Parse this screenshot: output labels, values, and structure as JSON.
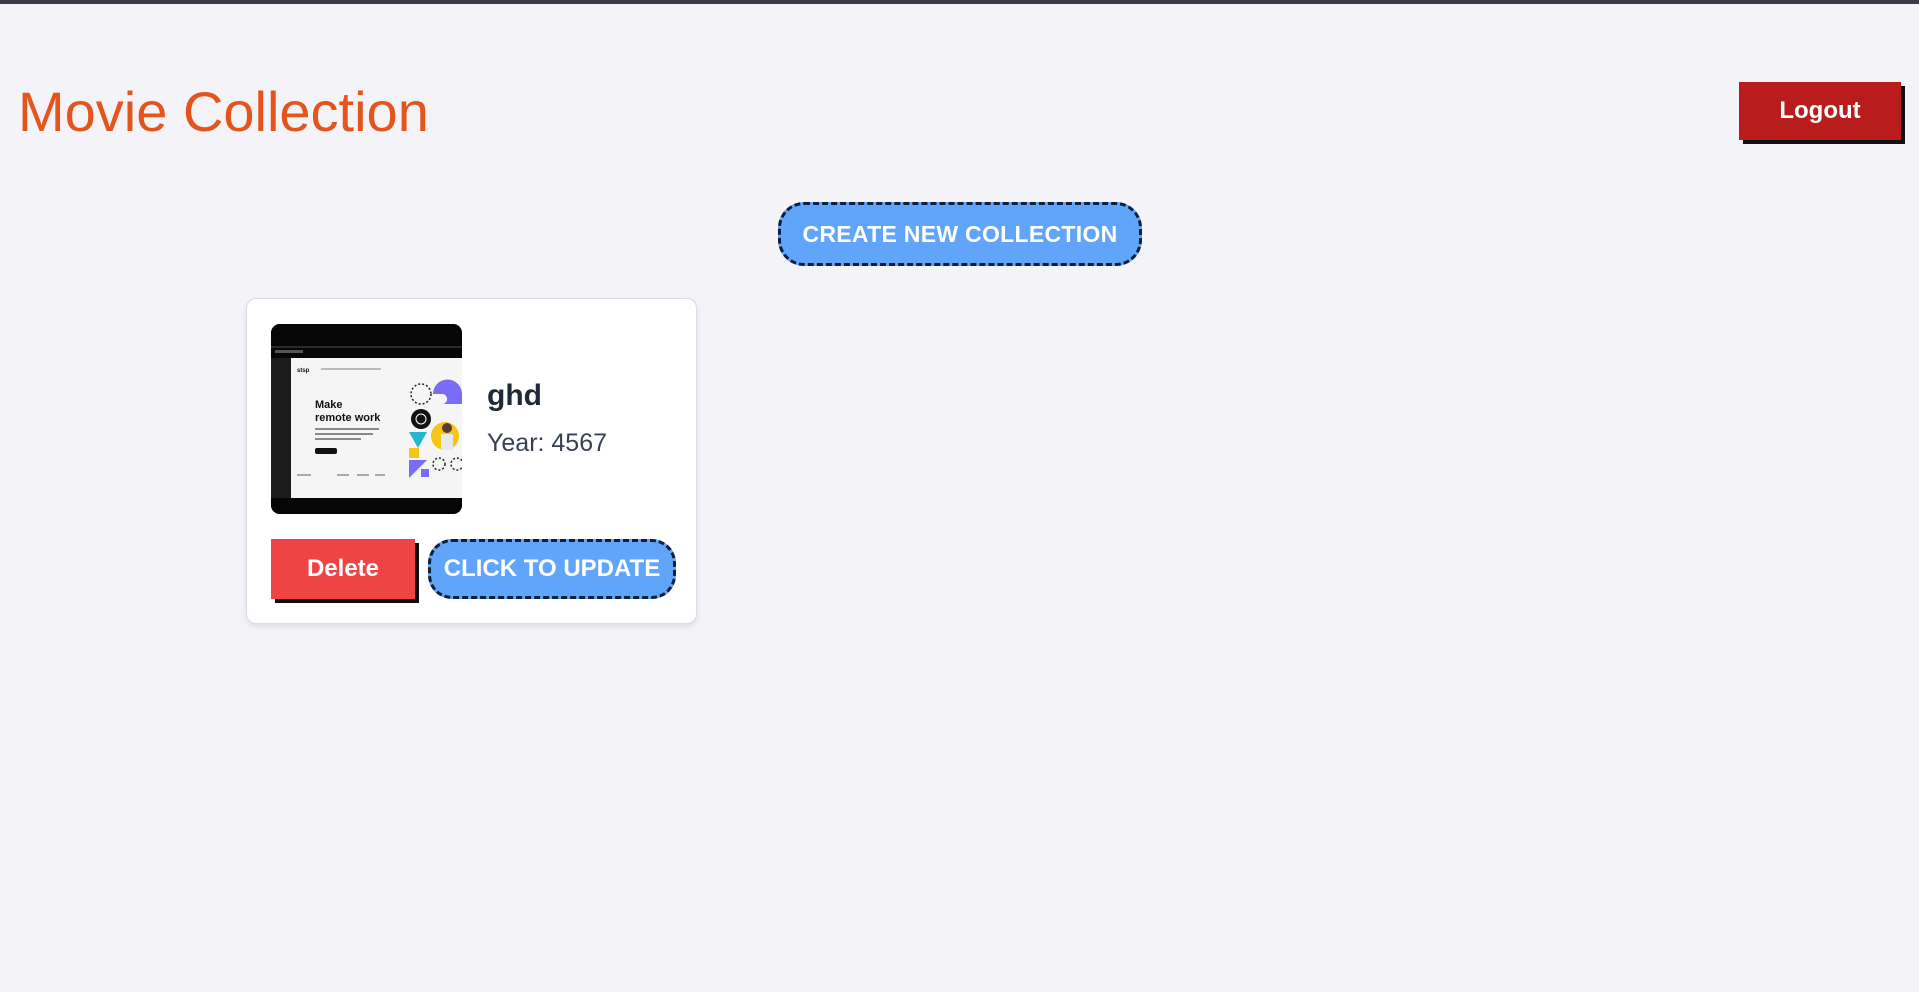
{
  "header": {
    "title": "Movie Collection",
    "logout_label": "Logout"
  },
  "actions": {
    "create_label": "CREATE NEW COLLECTION"
  },
  "movies": [
    {
      "title": "ghd",
      "year_text": "Year: 4567",
      "poster": {
        "headline_line1": "Make",
        "headline_line2": "remote work",
        "logo_text": "stsp"
      },
      "delete_label": "Delete",
      "update_label": "CLICK TO UPDATE"
    }
  ],
  "colors": {
    "title": "#e4541c",
    "logout": "#b91c1c",
    "delete": "#ef4444",
    "primary": "#60a5fa",
    "background": "#f4f3f8"
  }
}
